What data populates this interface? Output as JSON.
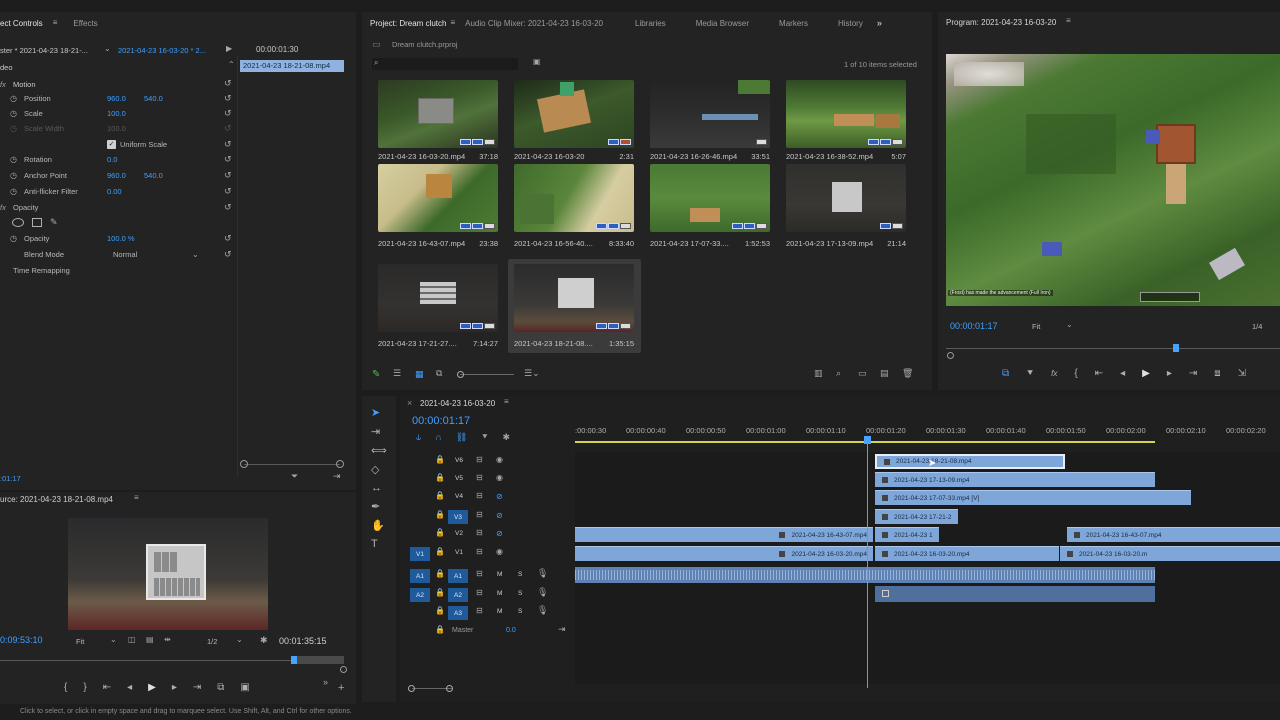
{
  "effect_controls": {
    "tabs": [
      "ect Controls",
      "Effects"
    ],
    "source_label": "ster * 2021-04-23 18-21-...",
    "sequence_label": "2021-04-23 16-03-20 * 2...",
    "timecode": "00:00:01:30",
    "clip_chip": "2021-04-23 18-21-08.mp4",
    "section_video": "deo",
    "motion_label": "Motion",
    "rows": [
      {
        "label": "Position",
        "v1": "960.0",
        "v2": "540.0"
      },
      {
        "label": "Scale",
        "v1": "100.0",
        "v2": ""
      },
      {
        "label": "Scale Width",
        "v1": "100.0",
        "v2": ""
      },
      {
        "label": "Rotation",
        "v1": "0.0",
        "v2": ""
      },
      {
        "label": "Anchor Point",
        "v1": "960.0",
        "v2": "540.0"
      },
      {
        "label": "Anti-flicker Filter",
        "v1": "0.00",
        "v2": ""
      }
    ],
    "uniform_scale": "Uniform Scale",
    "opacity_section": "Opacity",
    "opacity_label": "Opacity",
    "opacity_value": "100.0 %",
    "blend_label": "Blend Mode",
    "blend_value": "Normal",
    "time_remap": "Time Remapping",
    "bottom_timecode": ":01:17"
  },
  "source": {
    "title": "urce: 2021-04-23 18-21-08.mp4",
    "timecode_left": "0:09:53:10",
    "fit": "Fit",
    "ratio": "1/2",
    "timecode_right": "00:01:35:15"
  },
  "project": {
    "tabs": [
      "Project: Dream clutch",
      "Audio Clip Mixer: 2021-04-23 16-03-20",
      "Libraries",
      "Media Browser",
      "Markers",
      "History"
    ],
    "file": "Dream clutch.prproj",
    "selection": "1 of 10 items selected",
    "items": [
      {
        "name": "2021-04-23 16-03-20.mp4",
        "dur": "37:18"
      },
      {
        "name": "2021-04-23 16-03-20",
        "dur": "2:31"
      },
      {
        "name": "2021-04-23 16-26-46.mp4",
        "dur": "33:51"
      },
      {
        "name": "2021-04-23 16-38-52.mp4",
        "dur": "5:07"
      },
      {
        "name": "2021-04-23 16-43-07.mp4",
        "dur": "23:38"
      },
      {
        "name": "2021-04-23 16-56-40....",
        "dur": "8:33:40"
      },
      {
        "name": "2021-04-23 17-07-33....",
        "dur": "1:52:53"
      },
      {
        "name": "2021-04-23 17-13-09.mp4",
        "dur": "21:14"
      },
      {
        "name": "2021-04-23 17-21-27....",
        "dur": "7:14:27"
      },
      {
        "name": "2021-04-23 18-21-08....",
        "dur": "1:35:15"
      }
    ]
  },
  "program": {
    "title": "Program: 2021-04-23 16-03-20",
    "timecode": "00:00:01:17",
    "fit": "Fit",
    "ratio": "1/4",
    "game_chat": "(Frost) has made the advancement (Full Iron)"
  },
  "timeline": {
    "seq_name": "2021-04-23 16-03-20",
    "timecode": "00:00:01:17",
    "ruler": [
      ":00:00:30",
      "00:00:00:40",
      "00:00:00:50",
      "00:00:01:00",
      "00:00:01:10",
      "00:00:01:20",
      "00:00:01:30",
      "00:00:01:40",
      "00:00:01:50",
      "00:00:02:00",
      "00:00:02:10",
      "00:00:02:20"
    ],
    "video_tracks": [
      "V6",
      "V5",
      "V4",
      "V3",
      "V2",
      "V1"
    ],
    "audio_tracks": [
      "A1",
      "A2",
      "A3"
    ],
    "src_v": "V1",
    "src_a1": "A1",
    "src_a2": "A2",
    "m": "M",
    "s": "S",
    "master": "Master",
    "master_val": "0.0",
    "clips": {
      "v6": "2021-04-23 18-21-08.mp4",
      "v5": "2021-04-23 17-13-09.mp4",
      "v4": "2021-04-23 17-07-33.mp4 [V]",
      "v3": "2021-04-23 17-21-2",
      "v2a": "2021-04-23 16-43-07.mp4",
      "v2b": "2021-04-23 1",
      "v2c": "2021-04-23 16-43-07.mp4",
      "v1a": "2021-04-23 16-03-20.mp4",
      "v1b": "2021-04-23 16-03-20.mp4",
      "v1c": "2021-04-23 16-03-20.m"
    }
  },
  "status": "Click to select, or click in empty space and drag to marquee select. Use Shift, Alt, and Ctrl for other options.",
  "colors": {
    "accent": "#3fa0ff",
    "clip": "#7ea6d9",
    "audio": "#5e82b3",
    "playhead": "#4aa2ff"
  }
}
